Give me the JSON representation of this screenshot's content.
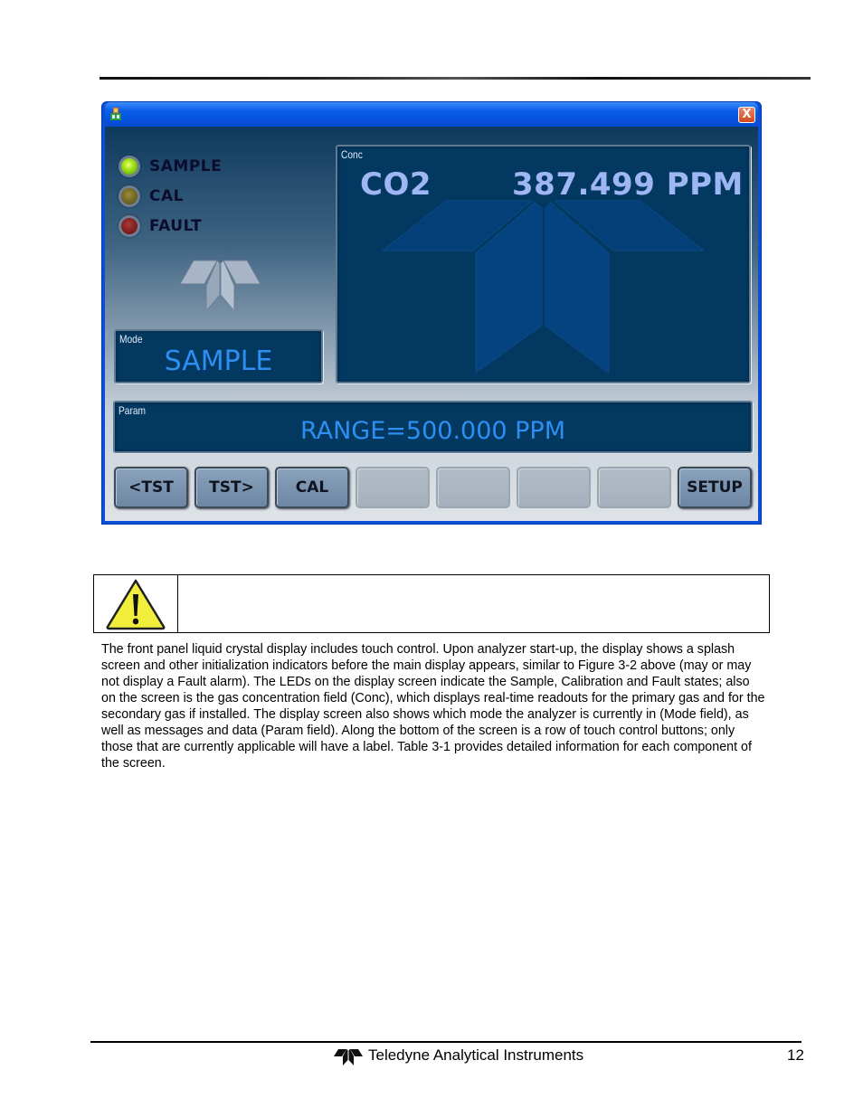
{
  "window": {
    "icon": "app-icon",
    "close_label": "X"
  },
  "leds": [
    {
      "label": "SAMPLE",
      "state": "on",
      "color": "#9de01a"
    },
    {
      "label": "CAL",
      "state": "off",
      "color": "#6e6420"
    },
    {
      "label": "FAULT",
      "state": "off",
      "color": "#7e1c1c"
    }
  ],
  "conc": {
    "caption": "Conc",
    "gas": "CO2",
    "value": "387.499 PPM"
  },
  "mode": {
    "caption": "Mode",
    "value": "SAMPLE"
  },
  "param": {
    "caption": "Param",
    "value": "RANGE=500.000 PPM"
  },
  "buttons": [
    {
      "label": "<TST",
      "enabled": true
    },
    {
      "label": "TST>",
      "enabled": true
    },
    {
      "label": "CAL",
      "enabled": true
    },
    {
      "label": "",
      "enabled": false
    },
    {
      "label": "",
      "enabled": false
    },
    {
      "label": "",
      "enabled": false
    },
    {
      "label": "",
      "enabled": false
    },
    {
      "label": "SETUP",
      "enabled": true
    }
  ],
  "caution": {
    "icon": "warning-icon",
    "text": ""
  },
  "body_paragraph": "The front panel liquid crystal display includes touch control. Upon analyzer start-up, the display shows a splash screen and other initialization indicators before the main display appears, similar to Figure 3-2 above (may or may not display a Fault alarm). The LEDs on the display screen indicate the Sample, Calibration and Fault states; also on the screen is the gas concentration field (Conc), which displays real-time readouts for the primary gas and for the secondary gas if installed. The display screen also shows which mode the analyzer is currently in (Mode field), as well as messages and data (Param field). Along the bottom of the screen is a row of touch control buttons; only those that are currently applicable will have a label. Table 3-1 provides detailed information for each component of the screen.",
  "footer": {
    "company": "Teledyne Analytical Instruments",
    "page_number": "12"
  }
}
